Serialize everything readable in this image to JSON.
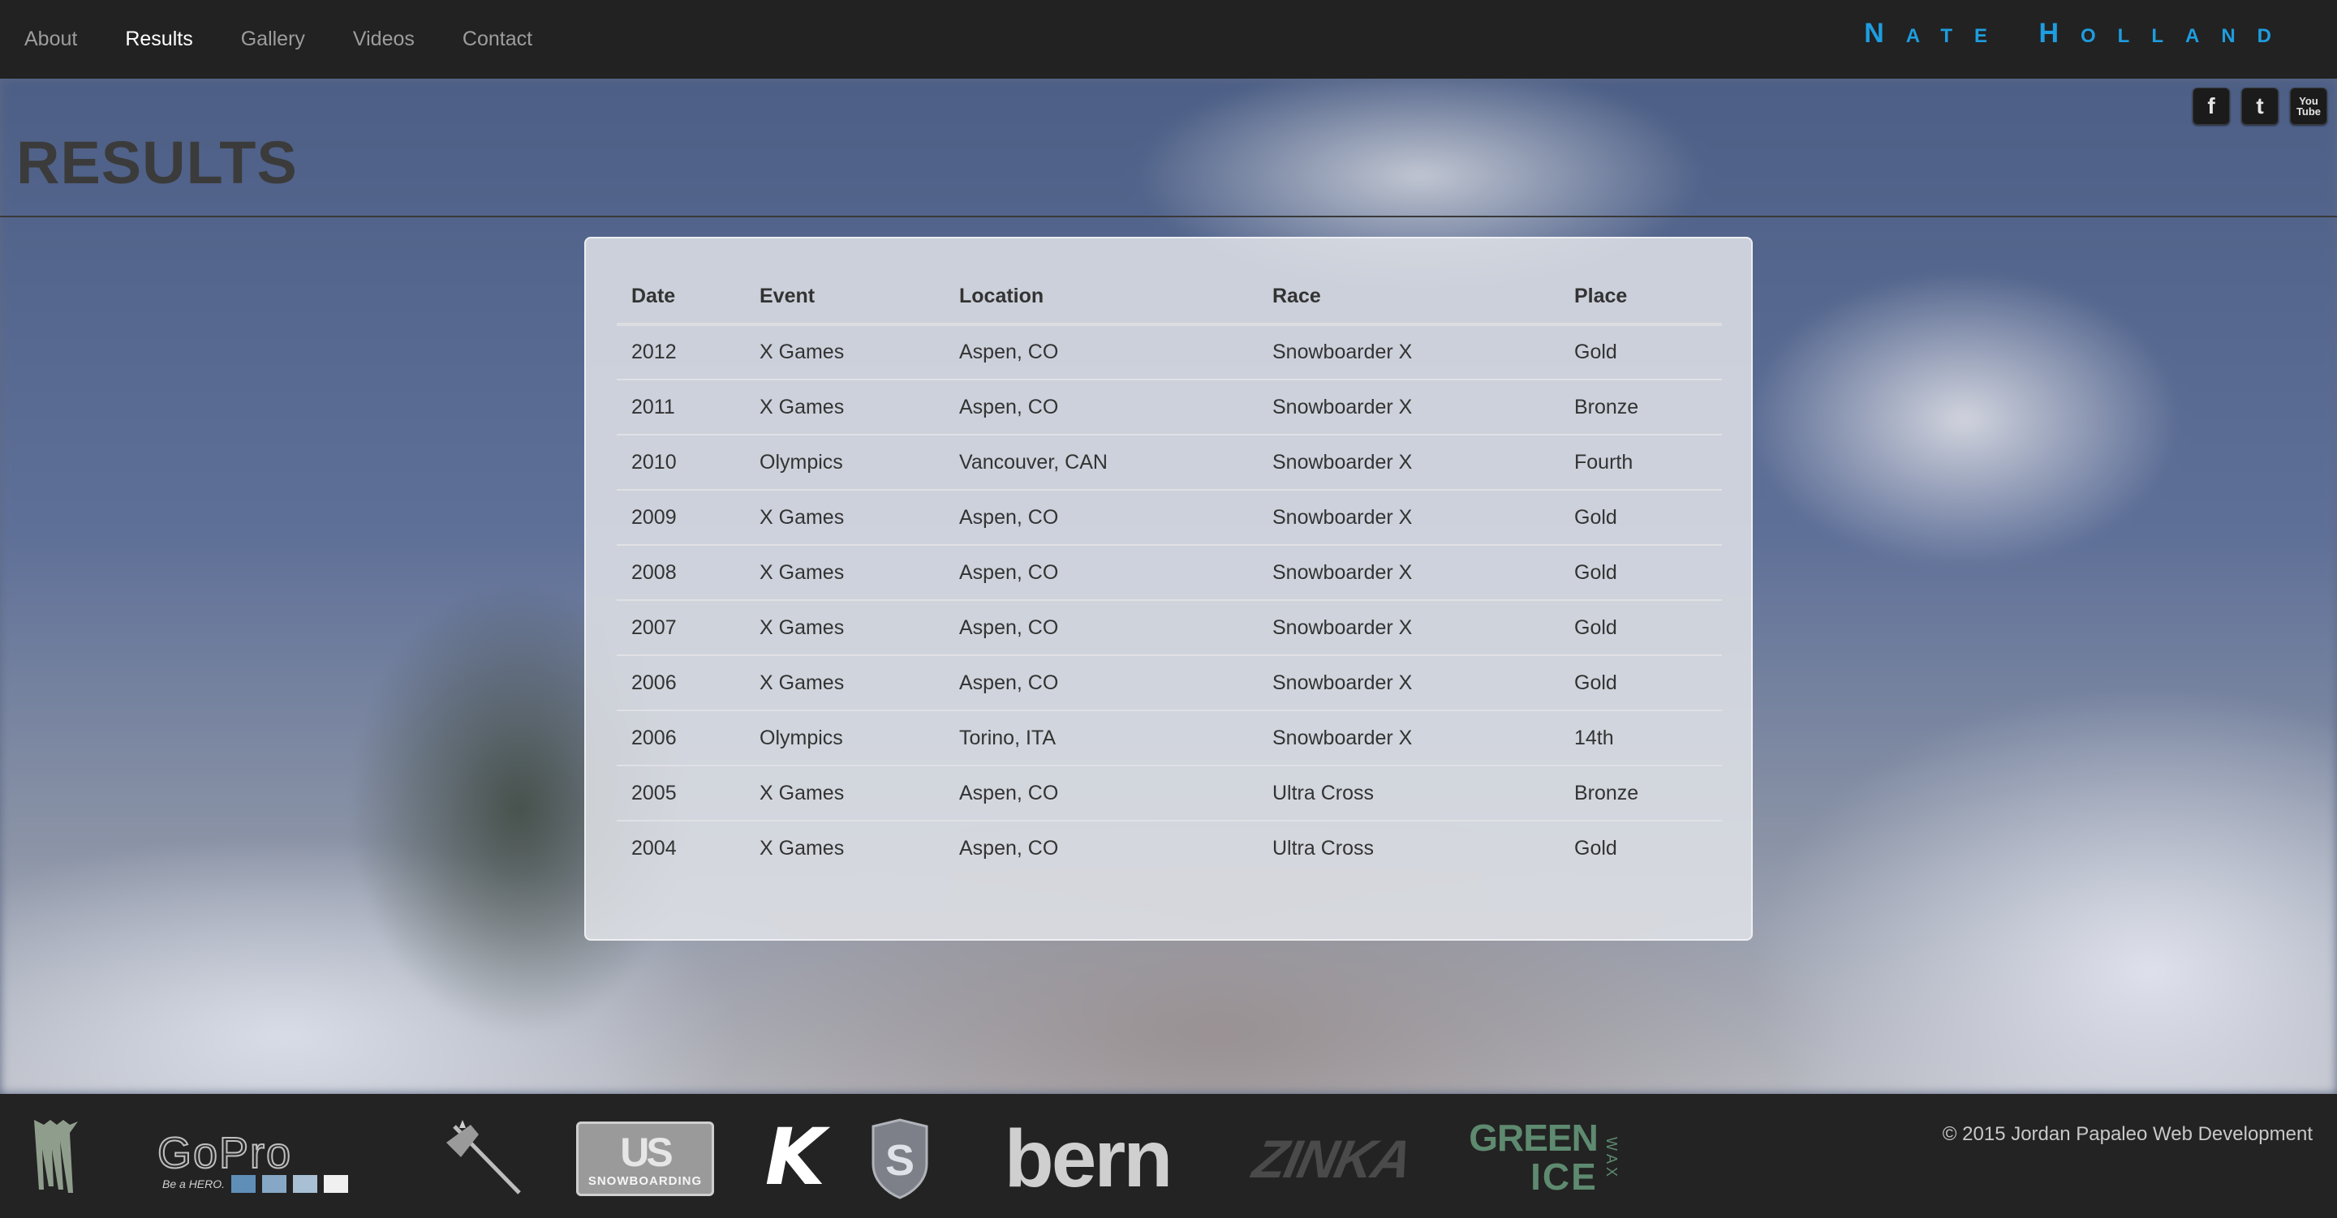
{
  "nav": {
    "links": [
      "About",
      "Results",
      "Gallery",
      "Videos",
      "Contact"
    ],
    "active": "Results",
    "brand": "Nate Holland"
  },
  "social": {
    "facebook": "f",
    "twitter": "t",
    "youtube": "You Tube"
  },
  "page": {
    "title": "RESULTS"
  },
  "results": {
    "headers": [
      "Date",
      "Event",
      "Location",
      "Race",
      "Place"
    ],
    "rows": [
      [
        "2012",
        "X Games",
        "Aspen, CO",
        "Snowboarder X",
        "Gold"
      ],
      [
        "2011",
        "X Games",
        "Aspen, CO",
        "Snowboarder X",
        "Bronze"
      ],
      [
        "2010",
        "Olympics",
        "Vancouver, CAN",
        "Snowboarder X",
        "Fourth"
      ],
      [
        "2009",
        "X Games",
        "Aspen, CO",
        "Snowboarder X",
        "Gold"
      ],
      [
        "2008",
        "X Games",
        "Aspen, CO",
        "Snowboarder X",
        "Gold"
      ],
      [
        "2007",
        "X Games",
        "Aspen, CO",
        "Snowboarder X",
        "Gold"
      ],
      [
        "2006",
        "X Games",
        "Aspen, CO",
        "Snowboarder X",
        "Gold"
      ],
      [
        "2006",
        "Olympics",
        "Torino, ITA",
        "Snowboarder X",
        "14th"
      ],
      [
        "2005",
        "X Games",
        "Aspen, CO",
        "Ultra Cross",
        "Bronze"
      ],
      [
        "2004",
        "X Games",
        "Aspen, CO",
        "Ultra Cross",
        "Gold"
      ]
    ]
  },
  "footer": {
    "sponsors": {
      "monster": "monster-energy-logo",
      "gopro": "GoPro",
      "gopro_tag": "Be a HERO.",
      "weapon": "tomahawk-logo",
      "us_snowboarding": "SNOWBOARDING",
      "k_logo": "K",
      "shield": "S",
      "bern": "bern",
      "zinka": "ZINKA",
      "green_ice_1": "GREEN",
      "green_ice_2": "ICE",
      "green_ice_wax": "W A X"
    },
    "copyright": "© 2015 Jordan Papaleo Web Development"
  },
  "colors": {
    "nav_bg": "#222222",
    "brand": "#1e9de0",
    "footer_bg": "#232323"
  }
}
